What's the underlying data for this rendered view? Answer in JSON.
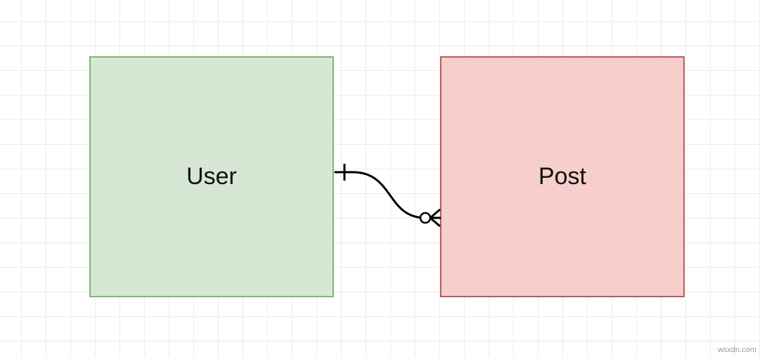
{
  "diagram": {
    "entities": {
      "user": {
        "label": "User"
      },
      "post": {
        "label": "Post"
      }
    },
    "relationship": {
      "from": "user",
      "to": "post",
      "from_cardinality": "one",
      "to_cardinality": "zero-or-many"
    }
  },
  "watermark": "wsxdn.com"
}
